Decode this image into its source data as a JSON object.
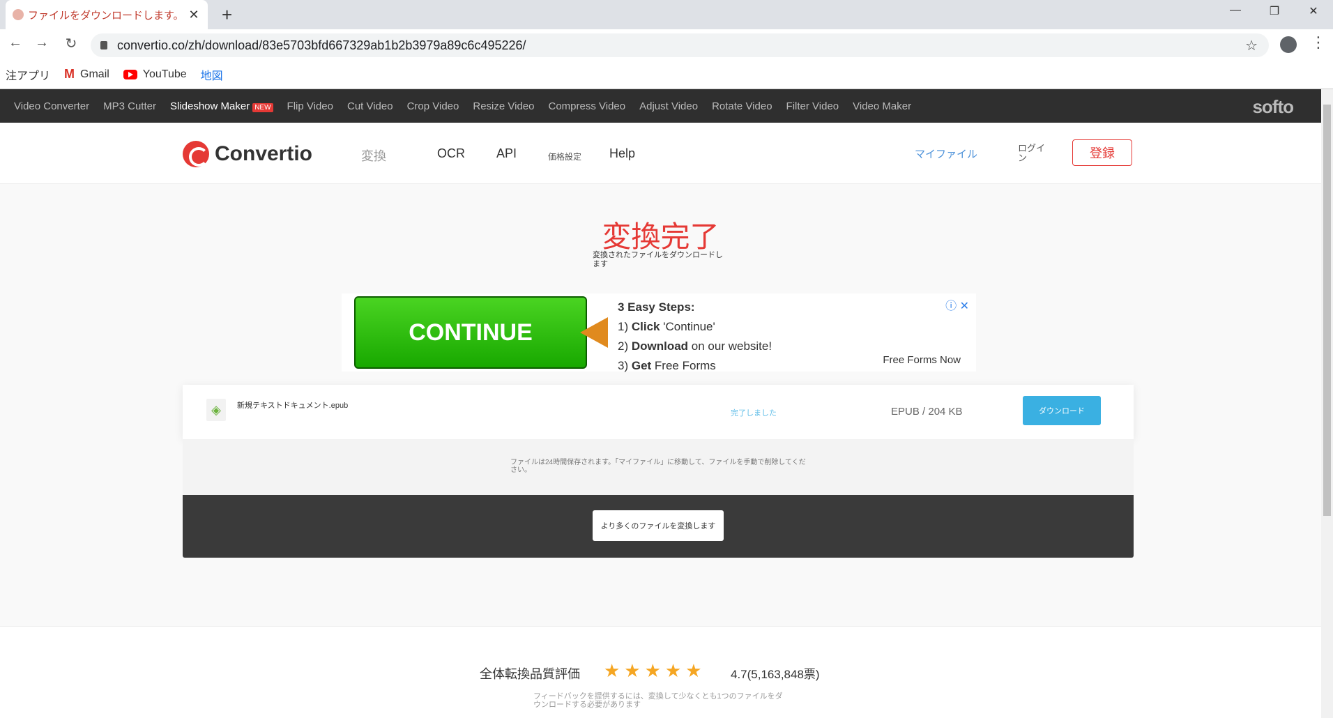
{
  "browser": {
    "tab_title": "ファイルをダウンロードします。",
    "url": "convertio.co/zh/download/83e5703bfd667329ab1b2b3979a89c6c495226/",
    "bookmarks": [
      {
        "label": "注アプリ",
        "icon": "apps-icon"
      },
      {
        "label": "Gmail",
        "icon": "gmail-icon"
      },
      {
        "label": "YouTube",
        "icon": "youtube-icon"
      },
      {
        "label": "地図",
        "icon": "maps-icon"
      }
    ]
  },
  "toolnav": {
    "items": [
      "Video Converter",
      "MP3 Cutter",
      "Slideshow Maker",
      "Flip Video",
      "Cut Video",
      "Crop Video",
      "Resize Video",
      "Compress Video",
      "Adjust Video",
      "Rotate Video",
      "Filter Video",
      "Video Maker"
    ],
    "new_badge": "NEW",
    "brand": "softo"
  },
  "header": {
    "logo": "Convertio",
    "nav": [
      "変換",
      "OCR",
      "API",
      "価格設定",
      "Help"
    ],
    "my_files": "マイファイル",
    "login": "ログイン",
    "register": "登録"
  },
  "main": {
    "title": "変換完了",
    "subtitle": "変換されたファイルをダウンロードします"
  },
  "ad": {
    "button": "CONTINUE",
    "steps_title": "3 Easy Steps:",
    "step1_bold": "Click",
    "step1_rest": "'Continue'",
    "step2_bold": "Download",
    "step2_rest": "on our website!",
    "step3_bold": "Get",
    "step3_rest": "Free Forms",
    "sponsor": "Free Forms Now"
  },
  "file": {
    "name": "新規テキストドキュメント.epub",
    "status": "完了しました",
    "size": "EPUB / 204 KB",
    "download": "ダウンロード"
  },
  "info": {
    "retention": "ファイルは24時間保存されます。「マイファイル」に移動して、ファイルを手動で削除してください。"
  },
  "convert_more": "より多くのファイルを変換します",
  "rating": {
    "label": "全体転換品質評価",
    "stars": 4.7,
    "value": "4.7(5,163,848票)",
    "feedback": "フィードバックを提供するには、変換して少なくとも1つのファイルをダウンロードする必要があります"
  },
  "colors": {
    "accent": "#e53935",
    "download": "#3ab0e2",
    "continue": "#18a800"
  }
}
